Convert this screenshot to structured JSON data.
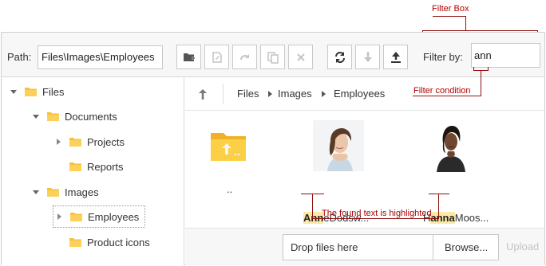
{
  "annotations": {
    "filter_box": "Filter Box",
    "filter_condition": "Filter condition",
    "found_text": "The found text is highlighted"
  },
  "toolbar": {
    "path_label": "Path:",
    "path_value": "Files\\Images\\Employees",
    "filter_label": "Filter by:",
    "filter_value": "ann",
    "buttons": [
      "create-folder",
      "rename",
      "move",
      "copy",
      "delete",
      "refresh",
      "download",
      "upload"
    ]
  },
  "tree": {
    "nodes": [
      {
        "label": "Files",
        "expanded": true
      },
      {
        "label": "Documents",
        "expanded": true
      },
      {
        "label": "Projects",
        "expanded": false
      },
      {
        "label": "Reports"
      },
      {
        "label": "Images",
        "expanded": true
      },
      {
        "label": "Employees",
        "expanded": false,
        "selected": true
      },
      {
        "label": "Product icons"
      }
    ]
  },
  "breadcrumb": [
    "Files",
    "Images",
    "Employees"
  ],
  "items": {
    "up_folder_label": "..",
    "file1": {
      "match": "Ann",
      "rest": "eDodsw..."
    },
    "file2": {
      "prefix": "H",
      "match": "anna",
      "rest": "Moos..."
    }
  },
  "upload": {
    "drop_text": "Drop files here",
    "browse_label": "Browse...",
    "upload_label": "Upload"
  },
  "colors": {
    "annotation": "#b00000",
    "folder": "#f5c13b",
    "highlight": "#fbe9a8"
  }
}
